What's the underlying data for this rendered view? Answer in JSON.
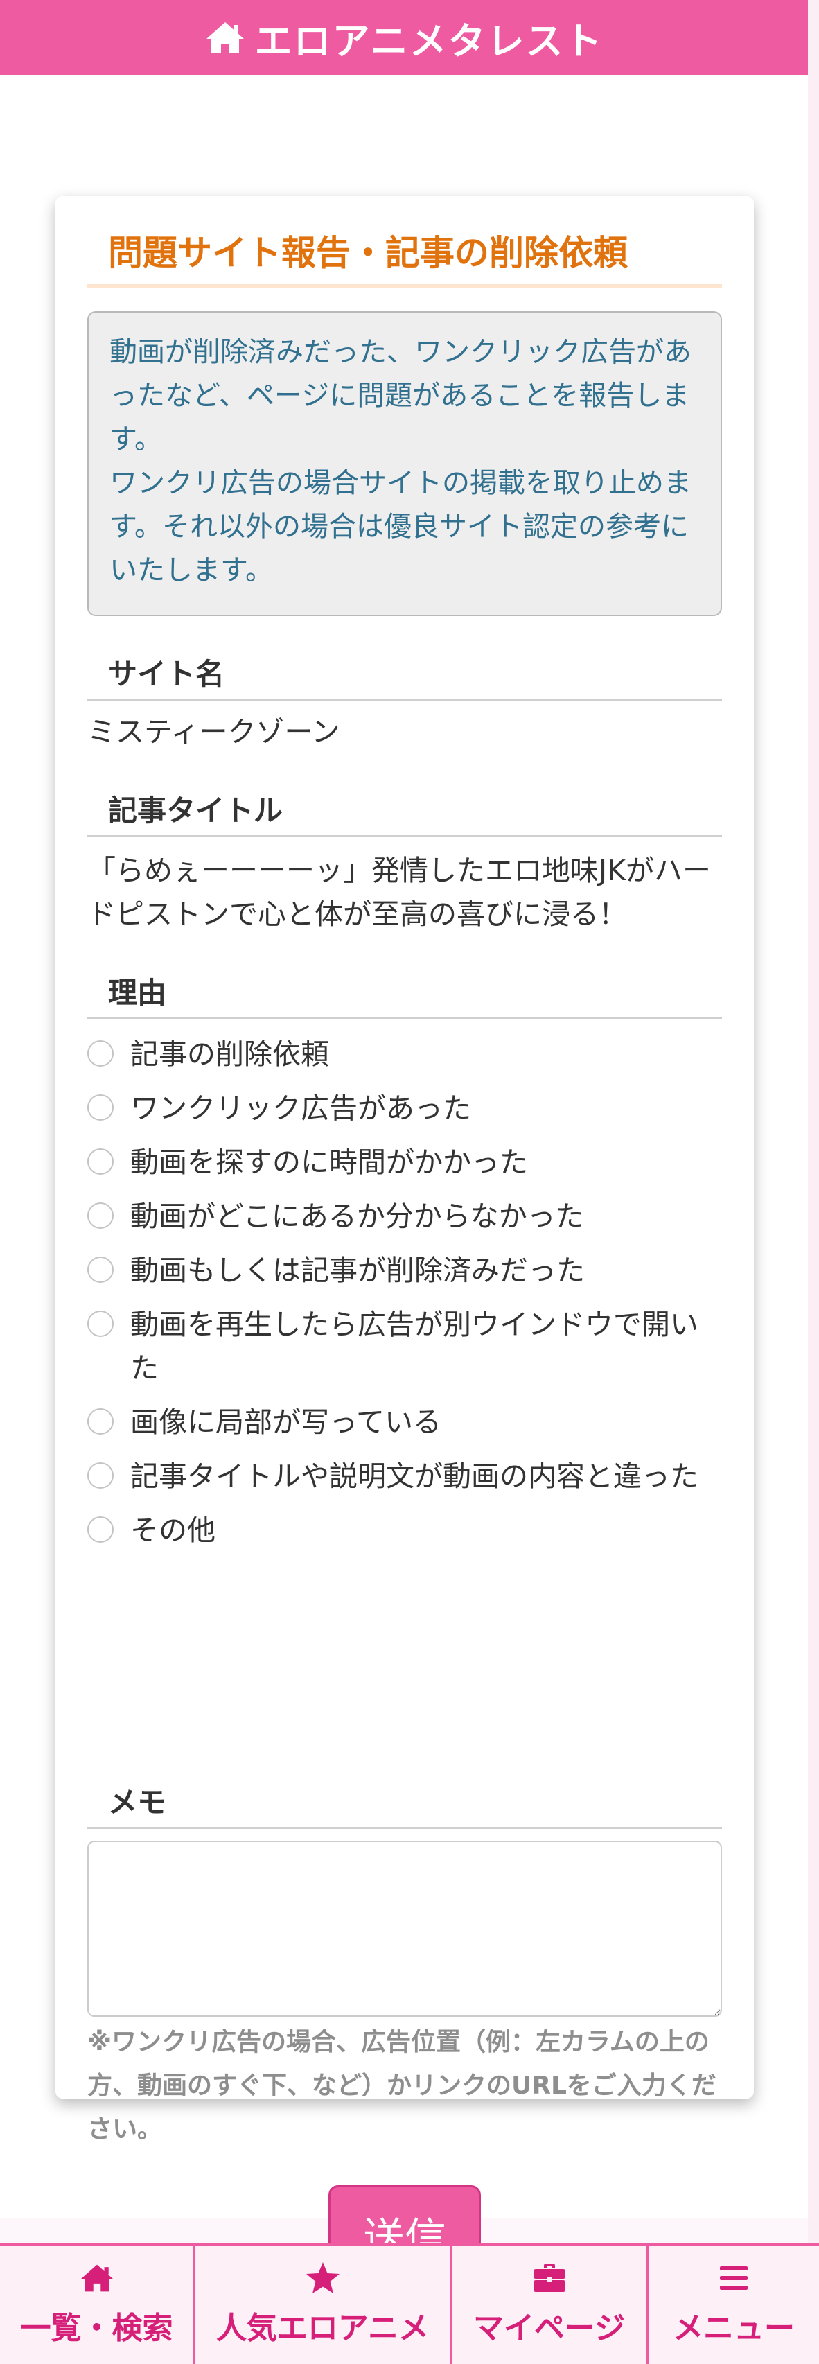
{
  "header": {
    "title": "エロアニメタレスト",
    "icon": "home-icon"
  },
  "form": {
    "title": "問題サイト報告・記事の削除依頼",
    "notice": {
      "paragraph1": "動画が削除済みだった、ワンクリック広告があったなど、ページに問題があることを報告します。",
      "paragraph2": "ワンクリ広告の場合サイトの掲載を取り止めます。それ以外の場合は優良サイト認定の参考にいたします。"
    },
    "site_name": {
      "label": "サイト名",
      "value": "ミスティークゾーン"
    },
    "article_title": {
      "label": "記事タイトル",
      "value": "「らめぇーーーーッ」発情したエロ地味JKがハードピストンで心と体が至高の喜びに浸る！"
    },
    "reason": {
      "label": "理由",
      "options": [
        "記事の削除依頼",
        "ワンクリック広告があった",
        "動画を探すのに時間がかかった",
        "動画がどこにあるか分からなかった",
        "動画もしくは記事が削除済みだった",
        "動画を再生したら広告が別ウインドウで開いた",
        "画像に局部が写っている",
        "記事タイトルや説明文が動画の内容と違った",
        "その他"
      ]
    },
    "memo": {
      "label": "メモ",
      "value": "",
      "help": "※ワンクリ広告の場合、広告位置（例：左カラムの上の方、動画のすぐ下、など）かリンクのURLをご入力ください。"
    },
    "submit_label": "送信"
  },
  "bottom_nav": {
    "items": [
      {
        "label": "一覧・検索",
        "icon": "home-icon"
      },
      {
        "label": "人気エロアニメ",
        "icon": "star-icon"
      },
      {
        "label": "マイページ",
        "icon": "briefcase-icon"
      },
      {
        "label": "メニュー",
        "icon": "menu-icon"
      }
    ]
  },
  "colors": {
    "brand_pink": "#ef5ba1",
    "title_orange": "#e0730e",
    "notice_text": "#31708f",
    "nav_text": "#d61f79"
  }
}
